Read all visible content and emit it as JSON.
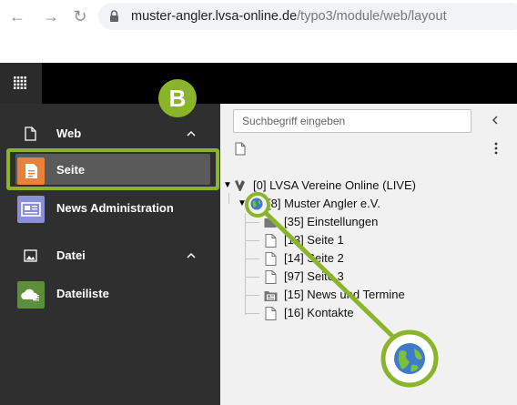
{
  "browser": {
    "back_icon": "arrow-left-icon",
    "forward_icon": "arrow-right-icon",
    "reload_icon": "reload-icon",
    "lock_icon": "lock-icon",
    "url_host": "muster-angler.lvsa-online.de",
    "url_path": "/typo3/module/web/layout"
  },
  "topbar": {
    "apps_icon": "app-grid-icon"
  },
  "module_menu": {
    "groups": [
      {
        "label": "Web",
        "icon": "page-outline-icon",
        "items": [
          {
            "label": "Seite",
            "icon": "page-module-icon",
            "color": "#e8823a",
            "active": true
          },
          {
            "label": "News Administration",
            "icon": "news-module-icon",
            "color": "#8a8fd6"
          }
        ]
      },
      {
        "label": "Datei",
        "icon": "image-icon",
        "items": [
          {
            "label": "Dateiliste",
            "icon": "filelist-module-icon",
            "color": "#5d8f3a"
          }
        ]
      }
    ]
  },
  "page_tree": {
    "search_placeholder": "Suchbegriff eingeben",
    "root": {
      "label": "[0] LVSA Vereine Online (LIVE)",
      "icon": "typo3-logo-icon",
      "expanded": true
    },
    "site": {
      "label": "[8] Muster Angler e.V.",
      "icon": "globe-icon",
      "expanded": true
    },
    "children": [
      {
        "label": "[35] Einstellungen",
        "icon": "folder-icon"
      },
      {
        "label": "[13] Seite 1",
        "icon": "page-icon"
      },
      {
        "label": "[14] Seite 2",
        "icon": "page-icon"
      },
      {
        "label": "[97] Seite 3",
        "icon": "page-icon"
      },
      {
        "label": "[15] News und Termine",
        "icon": "news-folder-icon"
      },
      {
        "label": "[16] Kontakte",
        "icon": "page-icon"
      }
    ]
  },
  "annotation": {
    "badge_label": "B",
    "color": "#8ab52a"
  }
}
